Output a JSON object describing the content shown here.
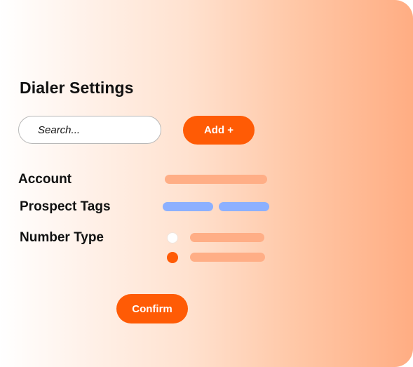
{
  "colors": {
    "accent": "#ff5b05",
    "placeholder_bar": "#ffae86",
    "tag_bar": "#8cb0ff",
    "panel_gradient_end": "#ffad83"
  },
  "page_title": "Dialer Settings",
  "search": {
    "placeholder": "Search...",
    "value": ""
  },
  "add_button": {
    "label": "Add +"
  },
  "form": {
    "account": {
      "label": "Account"
    },
    "prospect_tags": {
      "label": "Prospect Tags",
      "tag_count": 2
    },
    "number_type": {
      "label": "Number Type",
      "options": [
        {
          "selected": false
        },
        {
          "selected": true
        }
      ]
    }
  },
  "confirm_button": {
    "label": "Confirm"
  }
}
